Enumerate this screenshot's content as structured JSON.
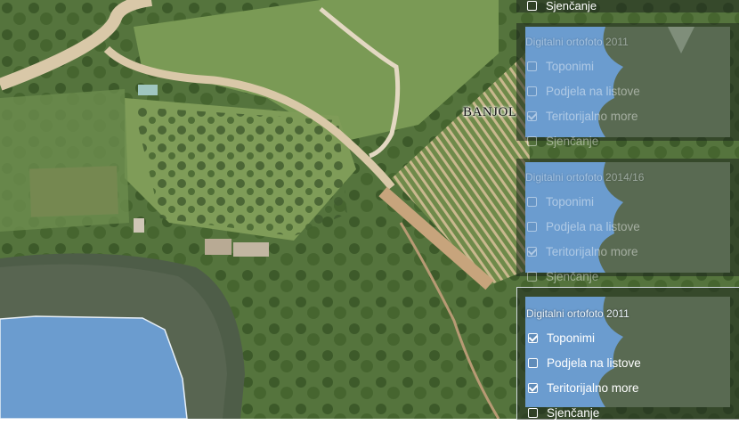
{
  "map": {
    "place_label": "BANJOL",
    "top_item_label": "Sjenčanje"
  },
  "panels": [
    {
      "title": "Digitalni ortofoto 2011",
      "state": "dimmed",
      "layers": [
        {
          "label": "Toponimi",
          "checked": false
        },
        {
          "label": "Podjela na listove",
          "checked": false
        },
        {
          "label": "Teritorijalno more",
          "checked": true
        },
        {
          "label": "Sjenčanje",
          "checked": false
        }
      ]
    },
    {
      "title": "Digitalni ortofoto 2014/16",
      "state": "dimmed",
      "layers": [
        {
          "label": "Toponimi",
          "checked": false
        },
        {
          "label": "Podjela na listove",
          "checked": false
        },
        {
          "label": "Teritorijalno more",
          "checked": true
        },
        {
          "label": "Sjenčanje",
          "checked": false
        }
      ]
    },
    {
      "title": "Digitalni ortofoto 2011",
      "state": "active",
      "layers": [
        {
          "label": "Toponimi",
          "checked": true
        },
        {
          "label": "Podjela na listove",
          "checked": false
        },
        {
          "label": "Teritorijalno more",
          "checked": true
        },
        {
          "label": "Sjenčanje",
          "checked": false
        }
      ]
    }
  ],
  "colors": {
    "sea_overlay": "#6b9ccf",
    "vegetation": "#5b7a44",
    "road": "#d9c8a8"
  }
}
